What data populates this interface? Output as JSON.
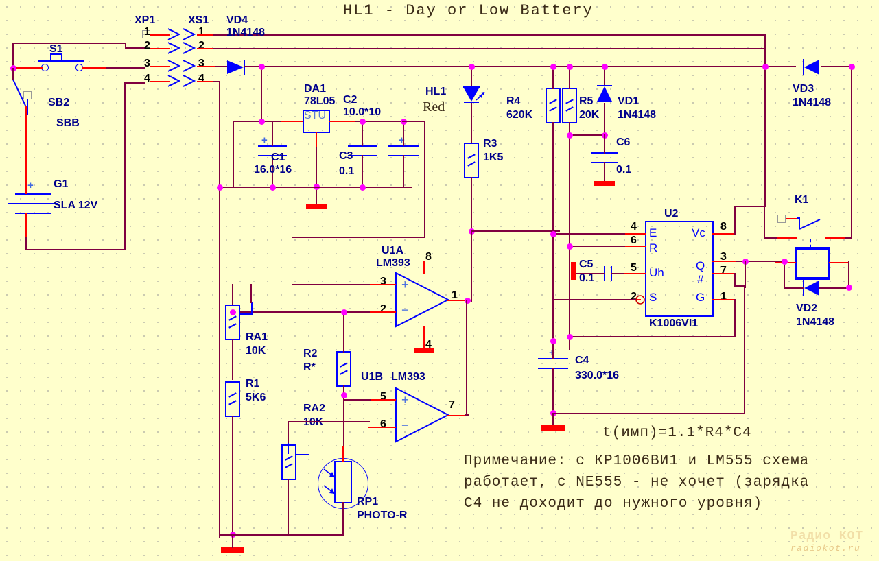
{
  "title": "HL1 - Day or Low Battery",
  "formula": "t(имп)=1.1*R4*C4",
  "note": {
    "line1": "Примечание: с КР1006ВИ1 и LM555 схема",
    "line2": "работает, с NE555 - не хочет (зарядка",
    "line3": "C4 не доходит до нужного уровня)"
  },
  "watermark": {
    "top": "Радио КОТ",
    "bottom": "radiokot.ru"
  },
  "colors": {
    "background": "#ffffcc",
    "wire": "#800040",
    "pin": "#ff0000",
    "symbol": "#0000ff",
    "junction": "#ff00ff",
    "ground": "#ff0000",
    "label": "#00008b"
  },
  "components": {
    "s1": {
      "ref": "S1",
      "type": "push-button"
    },
    "sb2": {
      "ref": "SB2",
      "value": "SBB",
      "type": "switch"
    },
    "g1": {
      "ref": "G1",
      "value": "SLA 12V",
      "type": "battery"
    },
    "xp1": {
      "ref": "XP1",
      "pins": [
        "1",
        "2",
        "3",
        "4"
      ]
    },
    "xs1": {
      "ref": "XS1",
      "pins": [
        "1",
        "2",
        "3",
        "4"
      ]
    },
    "vd4": {
      "ref": "VD4",
      "value": "1N4148"
    },
    "vd3": {
      "ref": "VD3",
      "value": "1N4148"
    },
    "vd2": {
      "ref": "VD2",
      "value": "1N4148"
    },
    "vd1": {
      "ref": "VD1",
      "value": "1N4148"
    },
    "da1": {
      "ref": "DA1",
      "value": "78L05",
      "body": "STU"
    },
    "c1": {
      "ref": "C1",
      "value": "16.0*16",
      "polarized": true
    },
    "c2": {
      "ref": "C2",
      "value": "10.0*10",
      "polarized": true
    },
    "c3": {
      "ref": "C3",
      "value": "0.1",
      "polarized": false
    },
    "c4": {
      "ref": "C4",
      "value": "330.0*16",
      "polarized": true
    },
    "c5": {
      "ref": "C5",
      "value": "0.1",
      "polarized": false
    },
    "c6": {
      "ref": "C6",
      "value": "0.1",
      "polarized": false
    },
    "hl1": {
      "ref": "HL1",
      "value": "Red",
      "type": "led"
    },
    "r3": {
      "ref": "R3",
      "value": "1K5"
    },
    "r4": {
      "ref": "R4",
      "value": "620K"
    },
    "r5": {
      "ref": "R5",
      "value": "20K"
    },
    "r1": {
      "ref": "R1",
      "value": "5K6"
    },
    "r2": {
      "ref": "R2",
      "value": "R*"
    },
    "ra1": {
      "ref": "RA1",
      "value": "10K",
      "type": "trimmer"
    },
    "ra2": {
      "ref": "RA2",
      "value": "10K",
      "type": "trimmer"
    },
    "rp1": {
      "ref": "RP1",
      "value": "PHOTO-R",
      "type": "photoresistor"
    },
    "u1a": {
      "ref": "U1A",
      "value": "LM393",
      "pins": {
        "in_p": "3",
        "in_n": "2",
        "out": "1",
        "vcc": "8",
        "gnd": "4"
      }
    },
    "u1b": {
      "ref": "U1B",
      "value": "LM393",
      "pins": {
        "in_p": "5",
        "in_n": "6",
        "out": "7"
      }
    },
    "u2": {
      "ref": "U2",
      "value": "K1006VI1",
      "left_pins": [
        {
          "num": "4",
          "name": "E"
        },
        {
          "num": "6",
          "name": "R"
        },
        {
          "num": "5",
          "name": "Uh"
        },
        {
          "num": "2",
          "name": "S"
        }
      ],
      "right_pins": [
        {
          "num": "8",
          "name": "Vc"
        },
        {
          "num": "3",
          "name": "Q"
        },
        {
          "num": "7",
          "name": "#"
        },
        {
          "num": "1",
          "name": "G"
        }
      ]
    },
    "k1": {
      "ref": "K1",
      "type": "relay"
    }
  }
}
